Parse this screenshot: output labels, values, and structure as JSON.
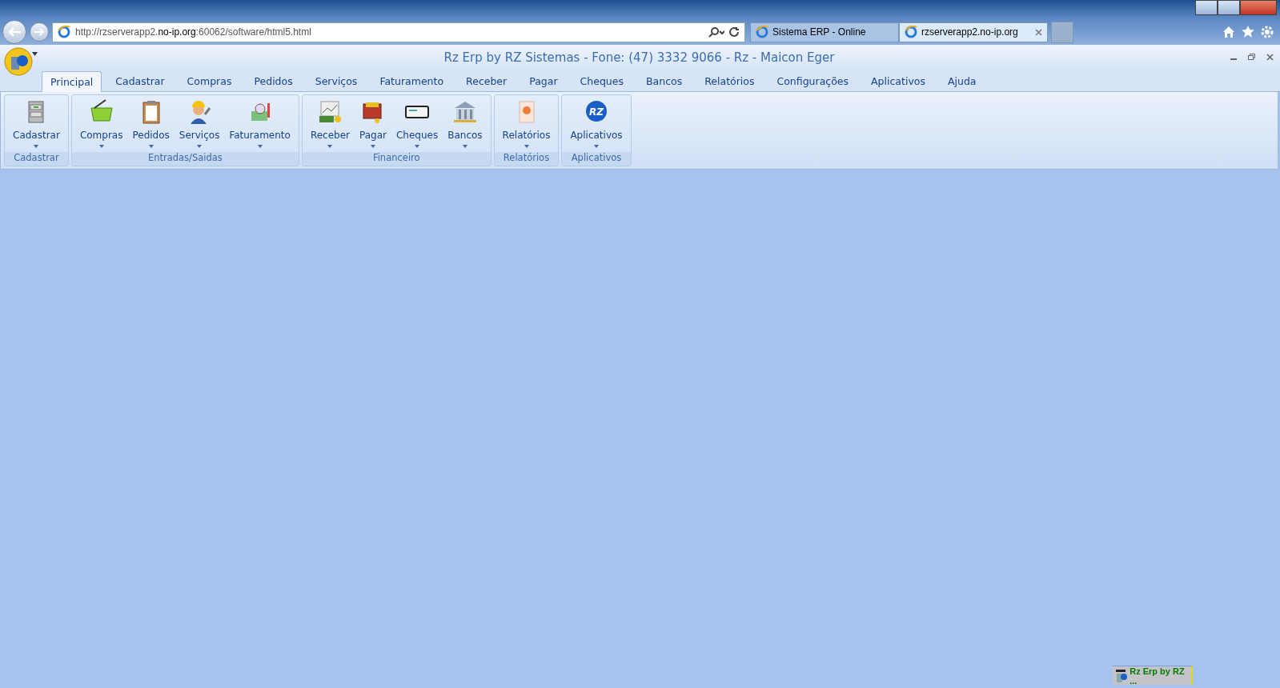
{
  "browser": {
    "address": "http://rzserverapp2.**no-ip.org**:60062/software/html5.html",
    "tabs": [
      {
        "title": "Sistema ERP - Online",
        "selected": false
      },
      {
        "title": "rzserverapp2.no-ip.org",
        "selected": true
      }
    ]
  },
  "app": {
    "title": "Rz Erp by RZ Sistemas - Fone: (47) 3332 9066 - Rz - Maicon Eger",
    "menu_tabs": [
      {
        "label": "Principal",
        "selected": true
      },
      {
        "label": "Cadastrar",
        "selected": false
      },
      {
        "label": "Compras",
        "selected": false
      },
      {
        "label": "Pedidos",
        "selected": false
      },
      {
        "label": "Serviços",
        "selected": false
      },
      {
        "label": "Faturamento",
        "selected": false
      },
      {
        "label": "Receber",
        "selected": false
      },
      {
        "label": "Pagar",
        "selected": false
      },
      {
        "label": "Cheques",
        "selected": false
      },
      {
        "label": "Bancos",
        "selected": false
      },
      {
        "label": "Relatórios",
        "selected": false
      },
      {
        "label": "Configurações",
        "selected": false
      },
      {
        "label": "Aplicativos",
        "selected": false
      },
      {
        "label": "Ajuda",
        "selected": false
      }
    ],
    "ribbon_groups": [
      {
        "label": "Cadastrar",
        "items": [
          {
            "label": "Cadastrar",
            "kind": "cabinet"
          }
        ]
      },
      {
        "label": "Entradas/Saidas",
        "items": [
          {
            "label": "Compras",
            "kind": "basket"
          },
          {
            "label": "Pedidos",
            "kind": "clipboard"
          },
          {
            "label": "Serviços",
            "kind": "worker"
          },
          {
            "label": "Faturamento",
            "kind": "chart"
          }
        ]
      },
      {
        "label": "Financeiro",
        "items": [
          {
            "label": "Receber",
            "kind": "money"
          },
          {
            "label": "Pagar",
            "kind": "wallet"
          },
          {
            "label": "Cheques",
            "kind": "cheque"
          },
          {
            "label": "Bancos",
            "kind": "bank"
          }
        ]
      },
      {
        "label": "Relatórios",
        "items": [
          {
            "label": "Relatórios",
            "kind": "report"
          }
        ]
      },
      {
        "label": "Aplicativos",
        "items": [
          {
            "label": "Aplicativos",
            "kind": "rz",
            "icon_text": "RZ"
          }
        ]
      }
    ]
  },
  "minimized_window": {
    "label": "Rz Erp by RZ ..."
  }
}
